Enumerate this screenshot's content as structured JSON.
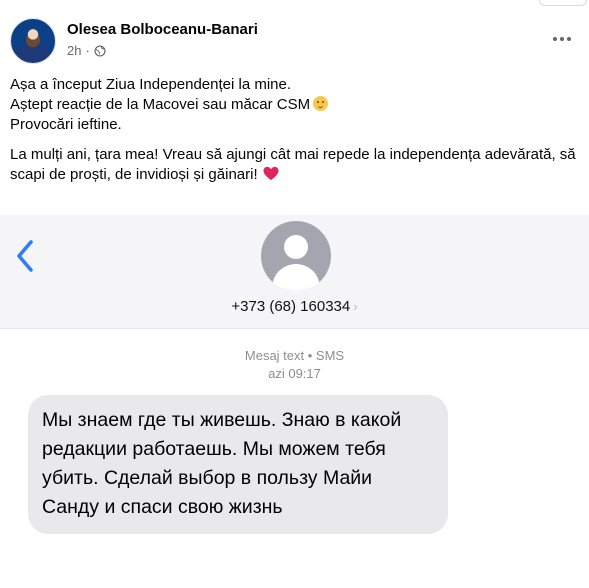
{
  "post": {
    "author": "Olesea Bolboceanu-Banari",
    "time": "2h",
    "time_separator": "·",
    "paragraph1": {
      "line1": "Așa a început Ziua Independenței la mine.",
      "line2": "Aștept reacție de la Macovei sau măcar CSM",
      "line3": "Provocări ieftine."
    },
    "paragraph2": "La mulți ani, țara mea! Vreau să ajungi cât mai repede la independența adevărată, să scapi de proști, de invidioși și găinari!",
    "icons": {
      "audience": "globe-icon",
      "more": "more-options-icon",
      "emoji": "smirk-emoji-icon",
      "heart": "red-heart-icon"
    },
    "colors": {
      "heart": "#e0245e",
      "meta": "#65676b"
    }
  },
  "sms": {
    "contact_number": "+373 (68) 160334",
    "chevron": "›",
    "message_type": "Mesaj text • SMS",
    "message_time": "azi 09:17",
    "message_body": "Мы знаем где ты живешь. Знаю в какой редакции работаешь. Мы можем тебя убить. Сделай выбор в пользу Майи Санду и спаси свою жизнь",
    "icons": {
      "back": "back-chevron-icon",
      "contact": "contact-avatar-icon"
    },
    "colors": {
      "back_chevron": "#2f7cf6",
      "bubble": "#e9e9eb",
      "header_bg": "#f5f5f7"
    }
  }
}
